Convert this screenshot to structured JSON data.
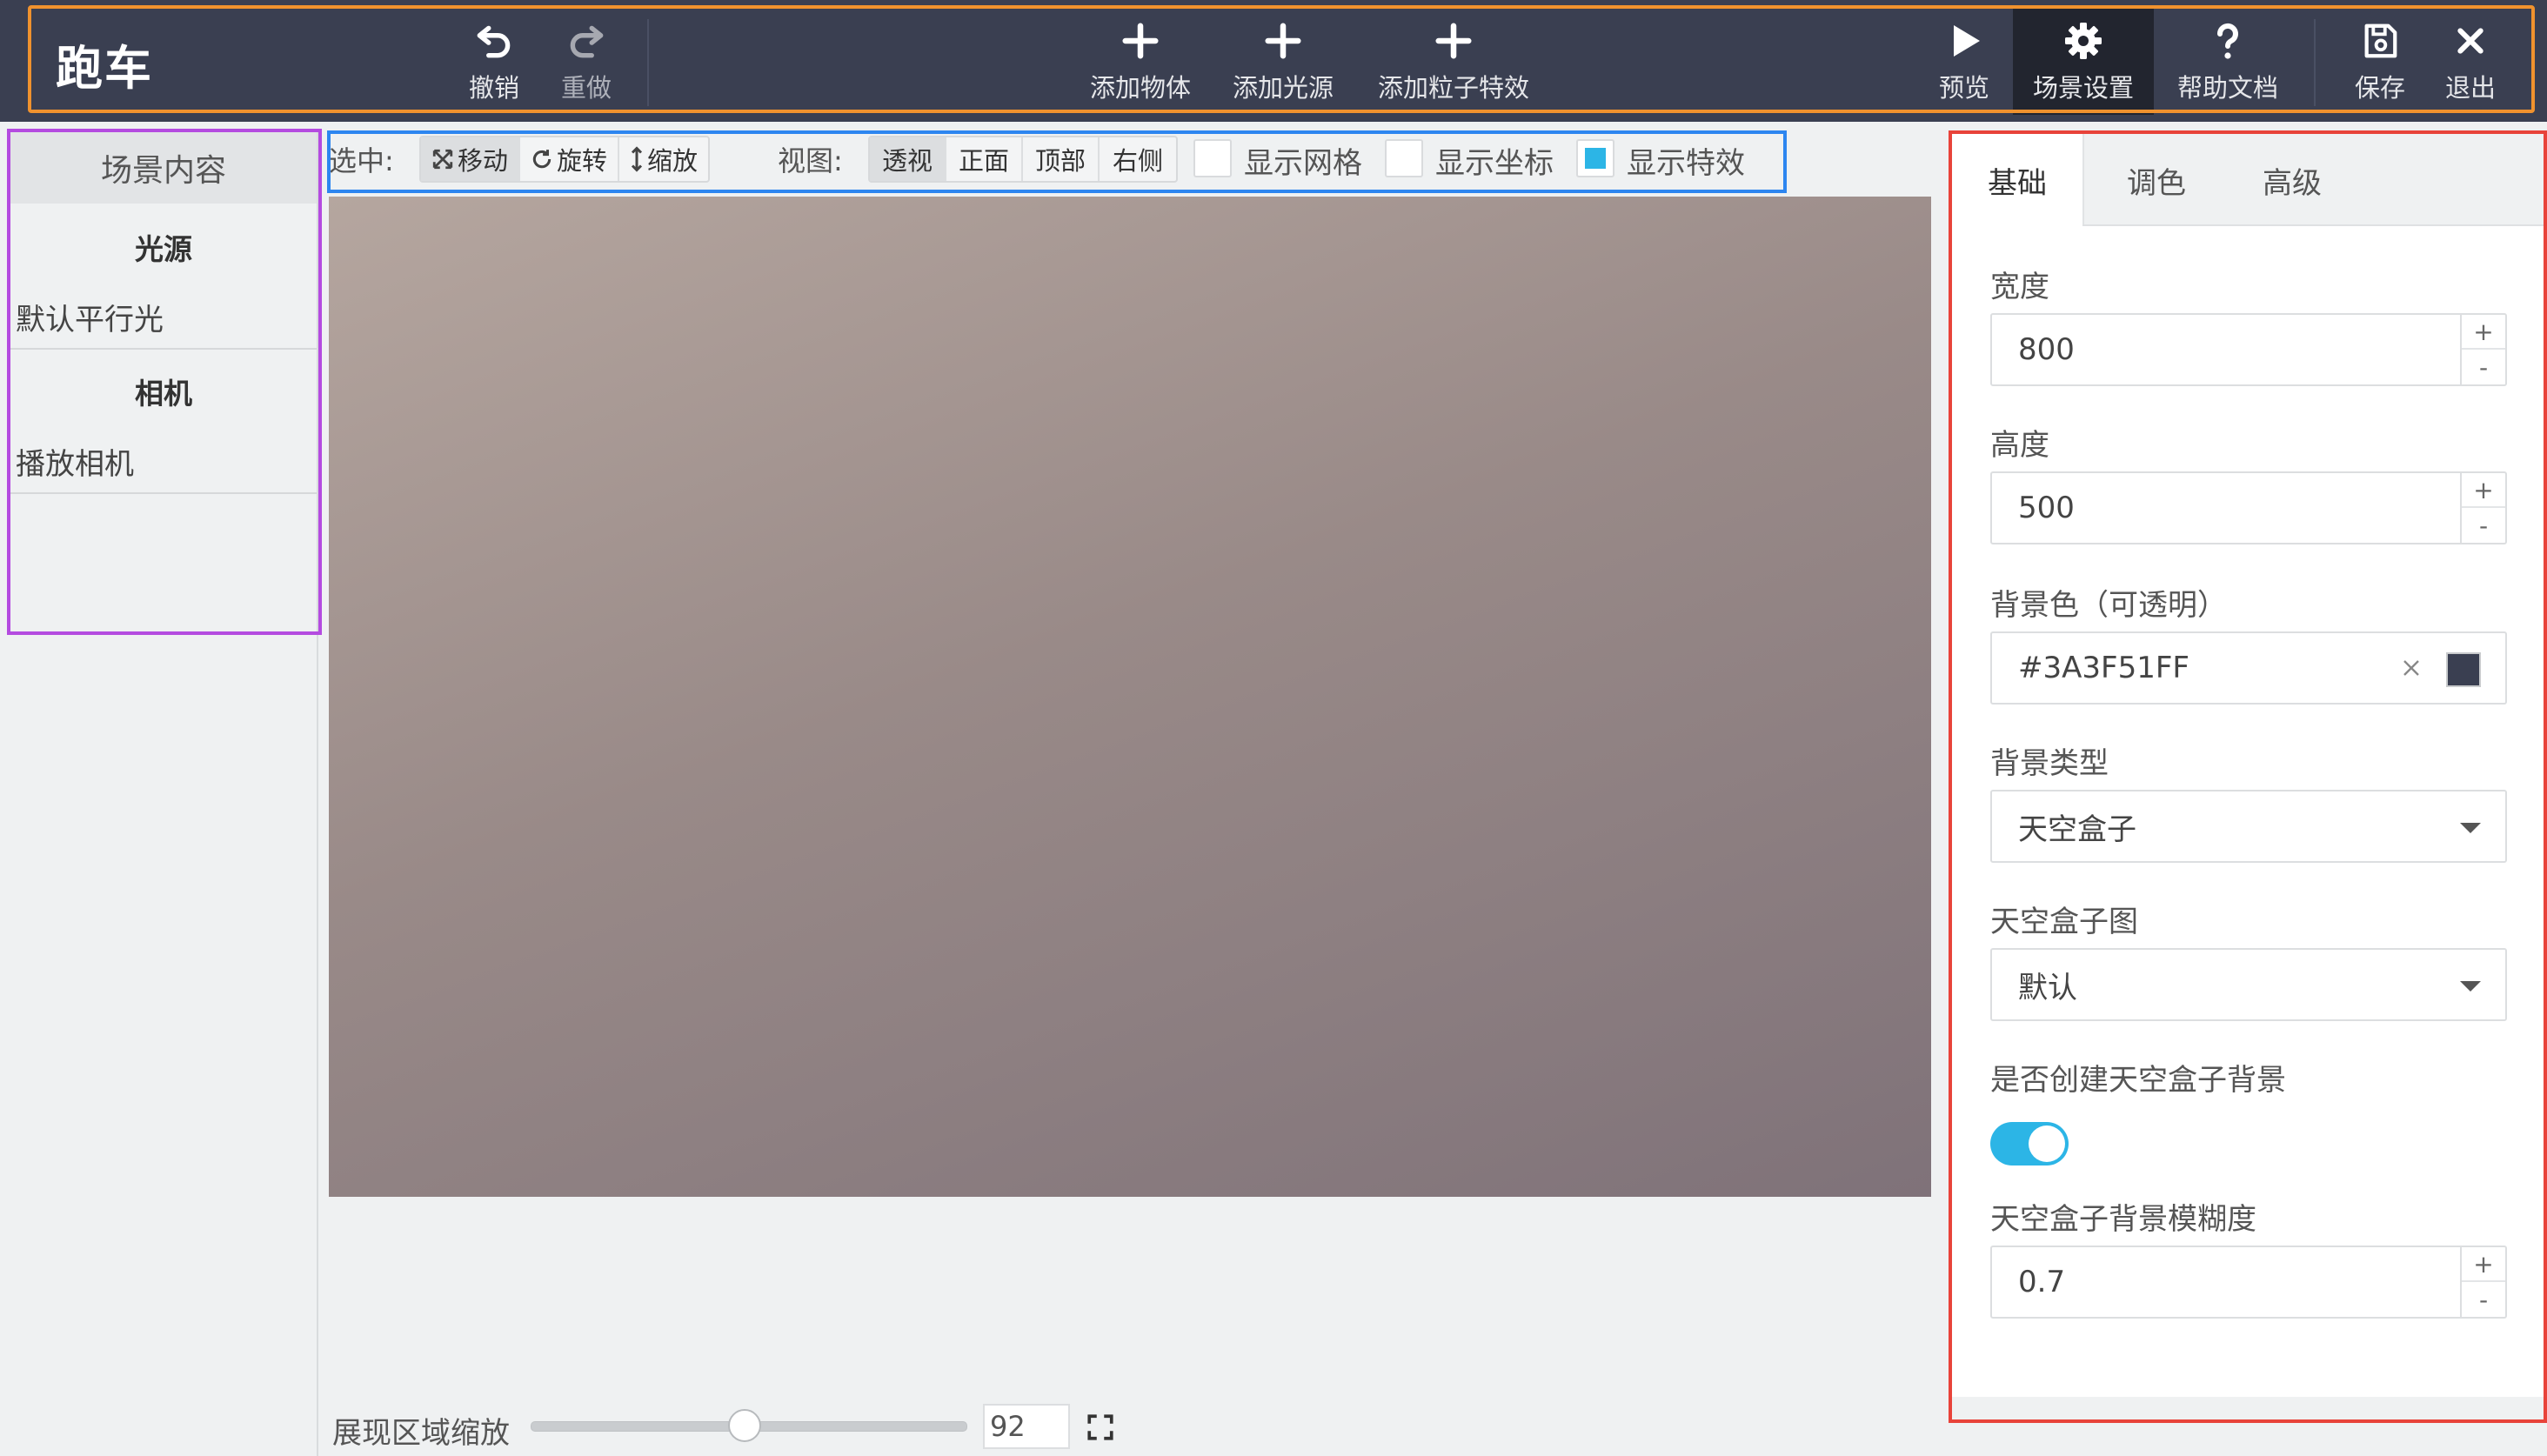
{
  "app": {
    "title": "跑车"
  },
  "toolbar": {
    "undo": "撤销",
    "redo": "重做",
    "add_object": "添加物体",
    "add_light": "添加光源",
    "add_particle": "添加粒子特效",
    "preview": "预览",
    "scene_settings": "场景设置",
    "help": "帮助文档",
    "save": "保存",
    "exit": "退出"
  },
  "scene_panel": {
    "title": "场景内容",
    "groups": [
      {
        "name": "光源",
        "items": [
          "默认平行光"
        ]
      },
      {
        "name": "相机",
        "items": [
          "播放相机"
        ]
      }
    ]
  },
  "canvas_toolbar": {
    "select_label": "选中:",
    "transform_modes": [
      "移动",
      "旋转",
      "缩放"
    ],
    "active_mode": "移动",
    "view_label": "视图:",
    "views": [
      "透视",
      "正面",
      "顶部",
      "右侧"
    ],
    "active_view": "透视",
    "checkboxes": [
      {
        "label": "显示网格",
        "checked": false
      },
      {
        "label": "显示坐标",
        "checked": false
      },
      {
        "label": "显示特效",
        "checked": true
      }
    ]
  },
  "zoom": {
    "label": "展现区域缩放",
    "value": "92"
  },
  "settings_panel": {
    "tabs": [
      "基础",
      "调色",
      "高级"
    ],
    "active_tab": "基础",
    "width": {
      "label": "宽度",
      "value": "800"
    },
    "height": {
      "label": "高度",
      "value": "500"
    },
    "bg_color": {
      "label": "背景色（可透明）",
      "value": "#3A3F51FF",
      "swatch": "#3a3f51"
    },
    "bg_type": {
      "label": "背景类型",
      "value": "天空盒子"
    },
    "skybox_image": {
      "label": "天空盒子图",
      "value": "默认"
    },
    "create_skybox_bg": {
      "label": "是否创建天空盒子背景",
      "on": true
    },
    "skybox_blur": {
      "label": "天空盒子背景模糊度",
      "value": "0.7"
    }
  },
  "colors": {
    "toolbar_bg": "#3a3f51",
    "accent": "#2cb5e6"
  }
}
